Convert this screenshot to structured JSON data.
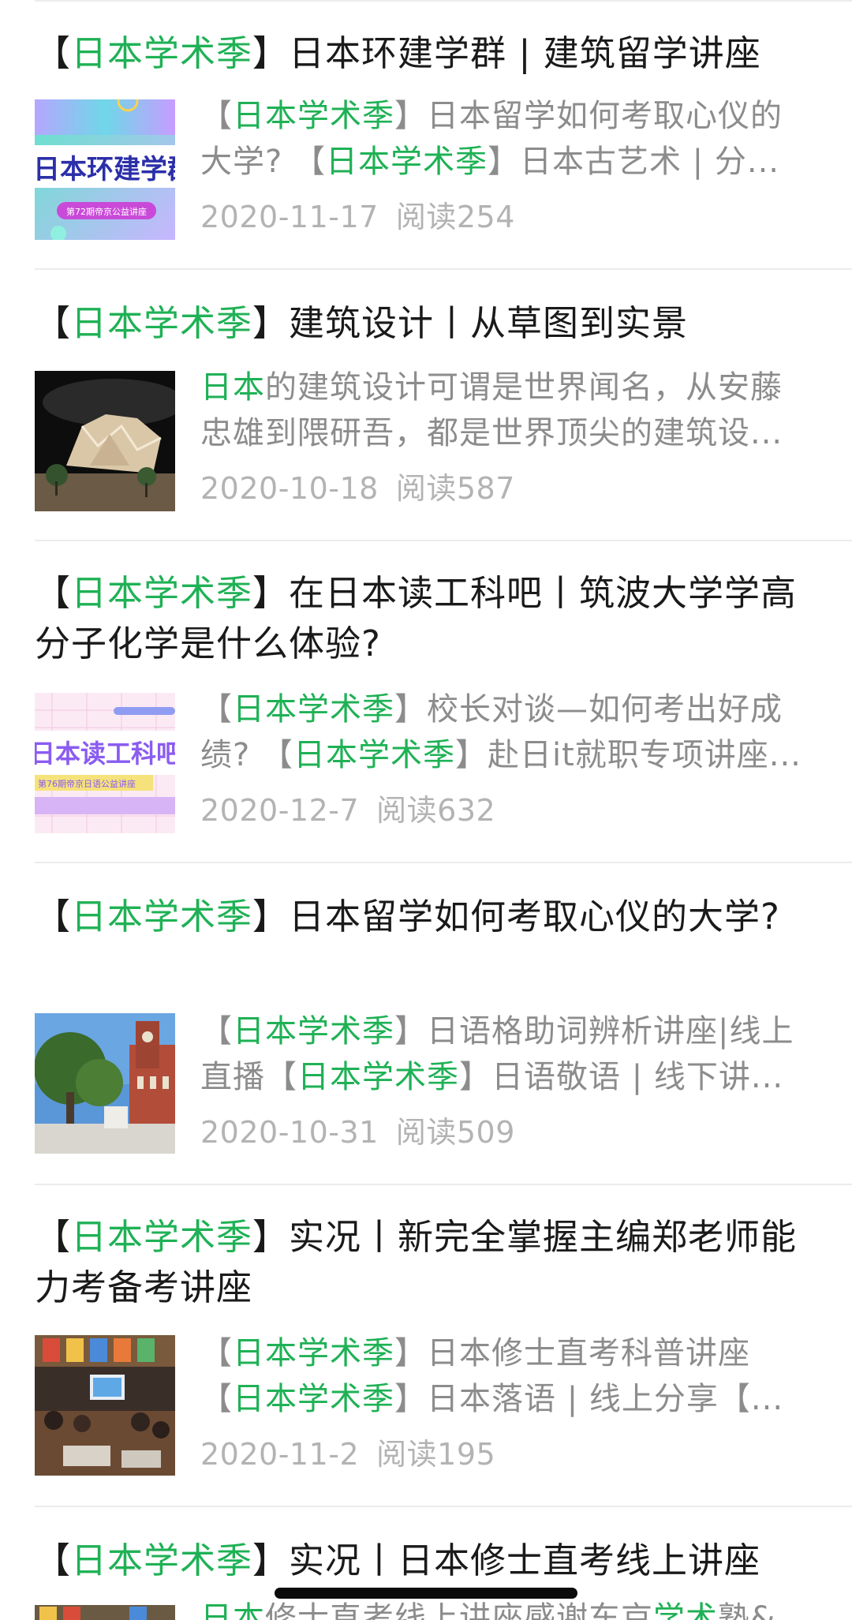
{
  "articles": [
    {
      "title_parts": [
        {
          "text": "【",
          "hl": false
        },
        {
          "text": "日本学术季",
          "hl": true
        },
        {
          "text": "】日本环建学群 | 建筑留学讲座",
          "hl": false
        }
      ],
      "summary_lines": [
        [
          {
            "text": "【",
            "hl": false
          },
          {
            "text": "日本学术季",
            "hl": true
          },
          {
            "text": "】日本留学如何考取心仪的",
            "hl": false
          }
        ],
        [
          {
            "text": "大学? 【",
            "hl": false
          },
          {
            "text": "日本学术季",
            "hl": true
          },
          {
            "text": "】日本古艺术 | 分...",
            "hl": false
          }
        ]
      ],
      "date": "2020-11-17",
      "reads": "阅读254",
      "thumb_text": "日本环建学群",
      "thumb_sub": "第72期帝京公益讲座"
    },
    {
      "title_parts": [
        {
          "text": "【",
          "hl": false
        },
        {
          "text": "日本学术季",
          "hl": true
        },
        {
          "text": "】建筑设计丨从草图到实景",
          "hl": false
        }
      ],
      "summary_lines": [
        [
          {
            "text": "日本",
            "hl": true
          },
          {
            "text": "的建筑设计可谓是世界闻名，从安藤",
            "hl": false
          }
        ],
        [
          {
            "text": "忠雄到隈研吾，都是世界顶尖的建筑设...",
            "hl": false
          }
        ]
      ],
      "date": "2020-10-18",
      "reads": "阅读587"
    },
    {
      "title_parts": [
        {
          "text": "【",
          "hl": false
        },
        {
          "text": "日本学术季",
          "hl": true
        },
        {
          "text": "】在日本读工科吧丨筑波大学学高分子化学是什么体验?",
          "hl": false
        }
      ],
      "summary_lines": [
        [
          {
            "text": "【",
            "hl": false
          },
          {
            "text": "日本学术季",
            "hl": true
          },
          {
            "text": "】校长对谈—如何考出好成",
            "hl": false
          }
        ],
        [
          {
            "text": "绩? 【",
            "hl": false
          },
          {
            "text": "日本学术季",
            "hl": true
          },
          {
            "text": "】赴日it就职专项讲座...",
            "hl": false
          }
        ]
      ],
      "date": "2020-12-7",
      "reads": "阅读632",
      "thumb_text": "日本读工科吧",
      "thumb_sub": "第76期帝京日语公益讲座"
    },
    {
      "title_parts": [
        {
          "text": "【",
          "hl": false
        },
        {
          "text": "日本学术季",
          "hl": true
        },
        {
          "text": "】日本留学如何考取心仪的大学?",
          "hl": false
        }
      ],
      "summary_lines": [
        [
          {
            "text": "【",
            "hl": false
          },
          {
            "text": "日本学术季",
            "hl": true
          },
          {
            "text": "】日语格助词辨析讲座|线上",
            "hl": false
          }
        ],
        [
          {
            "text": "直播【",
            "hl": false
          },
          {
            "text": "日本学术季",
            "hl": true
          },
          {
            "text": "】日语敬语 | 线下讲...",
            "hl": false
          }
        ]
      ],
      "date": "2020-10-31",
      "reads": "阅读509"
    },
    {
      "title_parts": [
        {
          "text": "【",
          "hl": false
        },
        {
          "text": "日本学术季",
          "hl": true
        },
        {
          "text": "】实况丨新完全掌握主编郑老师能力考备考讲座",
          "hl": false
        }
      ],
      "summary_lines": [
        [
          {
            "text": "【",
            "hl": false
          },
          {
            "text": "日本学术季",
            "hl": true
          },
          {
            "text": "】日本修士直考科普讲座",
            "hl": false
          }
        ],
        [
          {
            "text": "【",
            "hl": false
          },
          {
            "text": "日本学术季",
            "hl": true
          },
          {
            "text": "】日本落语 | 线上分享【...",
            "hl": false
          }
        ]
      ],
      "date": "2020-11-2",
      "reads": "阅读195"
    },
    {
      "title_parts": [
        {
          "text": "【",
          "hl": false
        },
        {
          "text": "日本学术季",
          "hl": true
        },
        {
          "text": "】实况丨日本修士直考线上讲座",
          "hl": false
        }
      ],
      "summary_lines": [
        [
          {
            "text": "日本",
            "hl": true
          },
          {
            "text": "修士直考线上讲座感谢东京",
            "hl": false
          },
          {
            "text": "学术",
            "hl": true
          },
          {
            "text": "塾&...",
            "hl": false
          }
        ]
      ],
      "date": "",
      "reads": ""
    }
  ],
  "colors": {
    "highlight": "#1fb155",
    "title": "#1a1a1a",
    "summary": "#8c8c8c",
    "meta": "#b3b3b3",
    "divider": "#ececec"
  }
}
